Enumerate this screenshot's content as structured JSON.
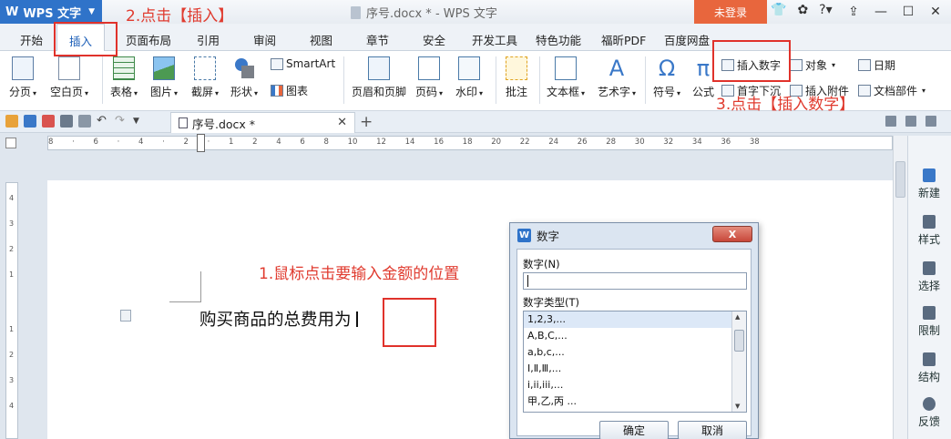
{
  "titlebar": {
    "app_name": "WPS 文字",
    "doc_title": "序号.docx * - WPS 文字",
    "login_label": "未登录"
  },
  "menu_tabs": [
    "开始",
    "插入",
    "页面布局",
    "引用",
    "审阅",
    "视图",
    "章节",
    "安全",
    "开发工具",
    "特色功能",
    "福昕PDF",
    "百度网盘"
  ],
  "active_tab": "插入",
  "ribbon": {
    "big_items": [
      {
        "label": "分页",
        "caret": "▾"
      },
      {
        "label": "空白页",
        "caret": "▾"
      },
      {
        "label": "表格",
        "caret": "▾"
      },
      {
        "label": "图片",
        "caret": "▾"
      },
      {
        "label": "截屏",
        "caret": "▾"
      },
      {
        "label": "形状",
        "caret": "▾"
      },
      {
        "label": "页眉和页脚",
        "caret": ""
      },
      {
        "label": "页码",
        "caret": "▾"
      },
      {
        "label": "水印",
        "caret": "▾"
      },
      {
        "label": "批注",
        "caret": ""
      },
      {
        "label": "文本框",
        "caret": "▾"
      },
      {
        "label": "艺术字",
        "caret": "▾"
      },
      {
        "label": "符号",
        "caret": "▾"
      },
      {
        "label": "公式",
        "caret": ""
      }
    ],
    "small_items": {
      "smartart": "SmartArt",
      "chart": "图表",
      "insert_number": "插入数字",
      "object": "对象",
      "date": "日期",
      "drop_cap": "首字下沉",
      "attachment": "插入附件",
      "doc_parts": "文档部件"
    }
  },
  "annotations": {
    "step1": "1.鼠标点击要输入金额的位置",
    "step2": "2.点击【插入】",
    "step3": "3.点击【插入数字】"
  },
  "doc_tab": {
    "name": "序号.docx *"
  },
  "ruler": {
    "h_numbers": "8 · 6 · 4 · 2 · 1 2 4 6 8 10 12 14 16 18 20 22 24 26 28 30 32 34 36 38",
    "v_numbers": [
      "4",
      "3",
      "2",
      "1",
      "1",
      "2",
      "3",
      "4"
    ]
  },
  "document": {
    "text": "购买商品的总费用为"
  },
  "side_panel": [
    "新建",
    "样式",
    "选择",
    "限制",
    "结构",
    "反馈"
  ],
  "dialog": {
    "title": "数字",
    "close_label": "X",
    "number_label": "数字(N)",
    "number_value": "",
    "type_label": "数字类型(T)",
    "types": [
      "1,2,3,...",
      "A,B,C,...",
      "a,b,c,...",
      "Ⅰ,Ⅱ,Ⅲ,...",
      "i,ii,iii,...",
      "甲,乙,丙 ..."
    ],
    "selected_type": "1,2,3,...",
    "ok_label": "确定",
    "cancel_label": "取消"
  },
  "colors": {
    "accent": "#2f73c9",
    "login": "#e8663d",
    "annotation": "#e03b2f"
  }
}
